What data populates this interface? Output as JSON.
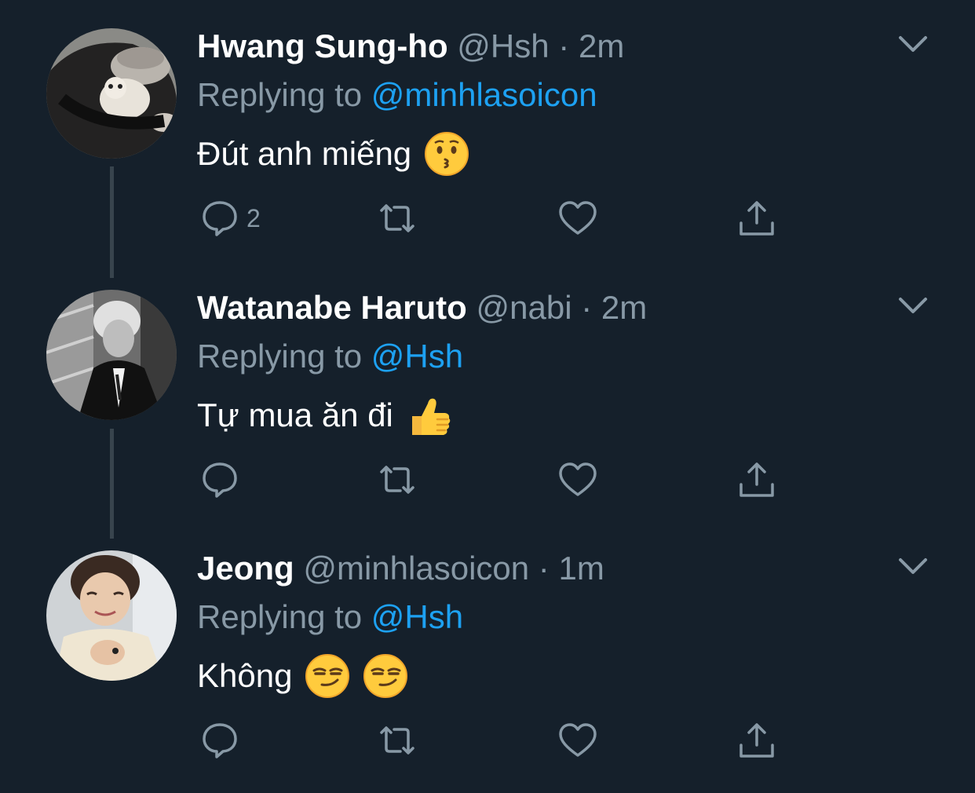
{
  "tweets": [
    {
      "display_name": "Hwang Sung-ho",
      "handle": "@Hsh",
      "separator": "·",
      "time": "2m",
      "replying_prefix": "Replying to",
      "replying_handle": "@minhlasoicon",
      "text": "Đút anh miếng",
      "emojis": [
        "kissing-face-emoji"
      ],
      "reply_count": "2",
      "avatar": "avatar-person-with-dog"
    },
    {
      "display_name": "Watanabe Haruto",
      "handle": "@nabi",
      "separator": "·",
      "time": "2m",
      "replying_prefix": "Replying to",
      "replying_handle": "@Hsh",
      "text": "Tự mua ăn đi",
      "emojis": [
        "thumbs-up-emoji"
      ],
      "reply_count": "",
      "avatar": "avatar-person-in-suit-bw"
    },
    {
      "display_name": "Jeong",
      "handle": "@minhlasoicon",
      "separator": "·",
      "time": "1m",
      "replying_prefix": "Replying to",
      "replying_handle": "@Hsh",
      "text": "Không",
      "emojis": [
        "smirking-face-emoji",
        "smirking-face-emoji"
      ],
      "reply_count": "",
      "avatar": "avatar-person-smiling"
    }
  ],
  "colors": {
    "background": "#15202b",
    "text_primary": "#ffffff",
    "text_secondary": "#8899a6",
    "link": "#1da1f2",
    "thread_line": "#38444d"
  },
  "icons": [
    "reply-icon",
    "retweet-icon",
    "like-icon",
    "share-icon",
    "chevron-down-icon"
  ]
}
